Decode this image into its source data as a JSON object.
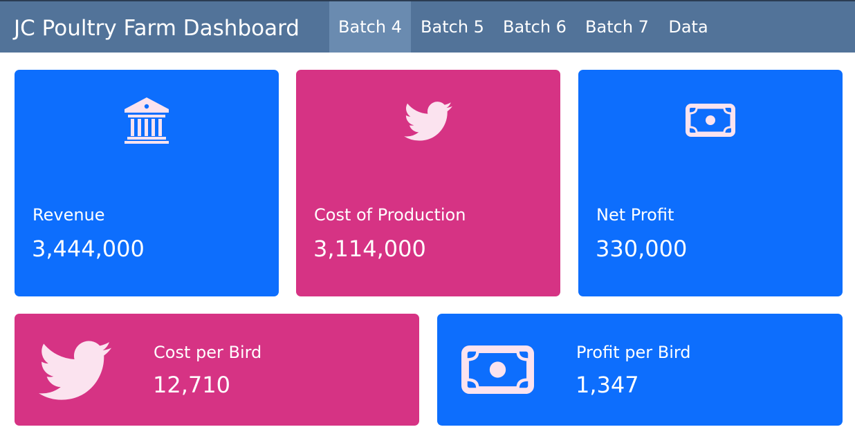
{
  "navbar": {
    "brand": "JC Poultry Farm Dashboard",
    "items": [
      {
        "label": "Batch 4",
        "active": true
      },
      {
        "label": "Batch 5",
        "active": false
      },
      {
        "label": "Batch 6",
        "active": false
      },
      {
        "label": "Batch 7",
        "active": false
      },
      {
        "label": "Data",
        "active": false
      }
    ]
  },
  "cards": {
    "revenue": {
      "label": "Revenue",
      "value": "3,444,000",
      "icon": "bank-icon",
      "color": "#0d6efd"
    },
    "cost_of_production": {
      "label": "Cost of Production",
      "value": "3,114,000",
      "icon": "bird-icon",
      "color": "#d63384"
    },
    "net_profit": {
      "label": "Net Profit",
      "value": "330,000",
      "icon": "cash-icon",
      "color": "#0d6efd"
    },
    "cost_per_bird": {
      "label": "Cost per Bird",
      "value": "12,710",
      "icon": "bird-icon",
      "color": "#d63384"
    },
    "profit_per_bird": {
      "label": "Profit per Bird",
      "value": "1,347",
      "icon": "cash-icon",
      "color": "#0d6efd"
    }
  },
  "colors": {
    "navbar": "#527399",
    "nav_active": "#6a8bb0",
    "card_blue": "#0d6efd",
    "card_pink": "#d63384",
    "icon_tint": "#fbe3ef"
  }
}
